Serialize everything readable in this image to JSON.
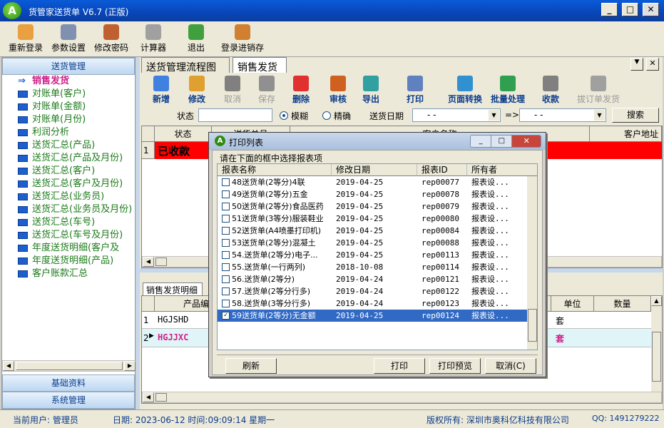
{
  "app": {
    "title": "货管家送货单 V6.7 (正版)",
    "logo": "A"
  },
  "winctrl": {
    "min": "_",
    "max": "□",
    "close": "✕"
  },
  "toolbar": [
    "重新登录",
    "参数设置",
    "修改密码",
    "计算器",
    "退出",
    "登录进销存"
  ],
  "left": {
    "header": "送货管理",
    "items": [
      "销售发货",
      "对账单(客户)",
      "对账单(金额)",
      "对账单(月份)",
      "利润分析",
      "送货汇总(产品)",
      "送货汇总(产品及月份)",
      "送货汇总(客户)",
      "送货汇总(客户及月份)",
      "送货汇总(业务员)",
      "送货汇总(业务员及月份)",
      "送货汇总(车号)",
      "送货汇总(车号及月份)",
      "年度送货明细(客户及",
      "年度送货明细(产品)",
      "客户账款汇总"
    ],
    "footer1": "基础资料",
    "footer2": "系统管理"
  },
  "tabs": [
    "送货管理流程图",
    "销售发货"
  ],
  "tabctrl": {
    "dd": "▼",
    "close": "✕"
  },
  "subtb": [
    {
      "l": "新增",
      "d": false
    },
    {
      "l": "修改",
      "d": false
    },
    {
      "l": "取消",
      "d": true
    },
    {
      "l": "保存",
      "d": true
    },
    {
      "l": "删除",
      "d": false
    },
    {
      "l": "审核",
      "d": false
    },
    {
      "l": "导出",
      "d": false
    },
    {
      "l": "打印",
      "d": false
    },
    {
      "l": "页面转换",
      "d": false
    },
    {
      "l": "批量处理",
      "d": false
    },
    {
      "l": "收款",
      "d": false
    },
    {
      "l": "拔订单发货",
      "d": true
    }
  ],
  "filter": {
    "status_label": "状态",
    "fuzzy": "模糊",
    "exact": "精确",
    "date_label": "送货日期",
    "date1": " -  - ",
    "arrow": "=>",
    "date2": " -  - ",
    "search": "搜索"
  },
  "grid1": {
    "h_status": "状态",
    "h_no": "送货单号",
    "h_name": "客户名称",
    "h_addr": "客户地址",
    "row_no": "1",
    "row_status": "已收款"
  },
  "grid2": {
    "tab": "销售发货明细",
    "h_code": "产品编码",
    "h_unit": "单位",
    "h_qty": "数量",
    "rows": [
      {
        "n": "1",
        "code": "HGJSHD",
        "unit": "套"
      },
      {
        "n": "2",
        "code": "HGJJXC",
        "unit": "套"
      }
    ]
  },
  "status": {
    "user": "当前用户: 管理员",
    "date": "日期: 2023-06-12  时间:09:09:14 星期一",
    "copyright": "版权所有: 深圳市奥科亿科技有限公司",
    "qq": "QQ: 1491279222"
  },
  "dialog": {
    "title": "打印列表",
    "group": "请在下面的框中选择报表项",
    "cols": [
      "报表名称",
      "修改日期",
      "报表ID",
      "所有者"
    ],
    "rows": [
      {
        "name": "48送货单(2等分)4联",
        "date": "2019-04-25",
        "id": "rep00077",
        "owner": "报表设...",
        "checked": false
      },
      {
        "name": "49送货单(2等分)五金",
        "date": "2019-04-25",
        "id": "rep00078",
        "owner": "报表设...",
        "checked": false
      },
      {
        "name": "50送货单(2等分)食品医药",
        "date": "2019-04-25",
        "id": "rep00079",
        "owner": "报表设...",
        "checked": false
      },
      {
        "name": "51送货单(3等分)服装鞋业",
        "date": "2019-04-25",
        "id": "rep00080",
        "owner": "报表设...",
        "checked": false
      },
      {
        "name": "52送货单(A4喷墨打印机)",
        "date": "2019-04-25",
        "id": "rep00084",
        "owner": "报表设...",
        "checked": false
      },
      {
        "name": "53送货单(2等分)混凝土",
        "date": "2019-04-25",
        "id": "rep00088",
        "owner": "报表设...",
        "checked": false
      },
      {
        "name": "54.送货单(2等分)电子...",
        "date": "2019-04-25",
        "id": "rep00113",
        "owner": "报表设...",
        "checked": false
      },
      {
        "name": "55.送货单(一行两列)",
        "date": "2018-10-08",
        "id": "rep00114",
        "owner": "报表设...",
        "checked": false
      },
      {
        "name": "56.送货单(2等分)",
        "date": "2019-04-24",
        "id": "rep00121",
        "owner": "报表设...",
        "checked": false
      },
      {
        "name": "57.送货单(2等分行多)",
        "date": "2019-04-24",
        "id": "rep00122",
        "owner": "报表设...",
        "checked": false
      },
      {
        "name": "58.送货单(3等分行多)",
        "date": "2019-04-24",
        "id": "rep00123",
        "owner": "报表设...",
        "checked": false
      },
      {
        "name": "59送货单(2等分)无金额",
        "date": "2019-04-25",
        "id": "rep00124",
        "owner": "报表设...",
        "checked": true
      }
    ],
    "btn_refresh": "刷新",
    "btn_print": "打印",
    "btn_preview": "打印预览",
    "btn_cancel": "取消(C)"
  },
  "colors": {
    "title": "#0846b8",
    "accent": "#316ac5",
    "red": "#ff0000",
    "green": "#1a7a18",
    "pink": "#d0208a"
  }
}
